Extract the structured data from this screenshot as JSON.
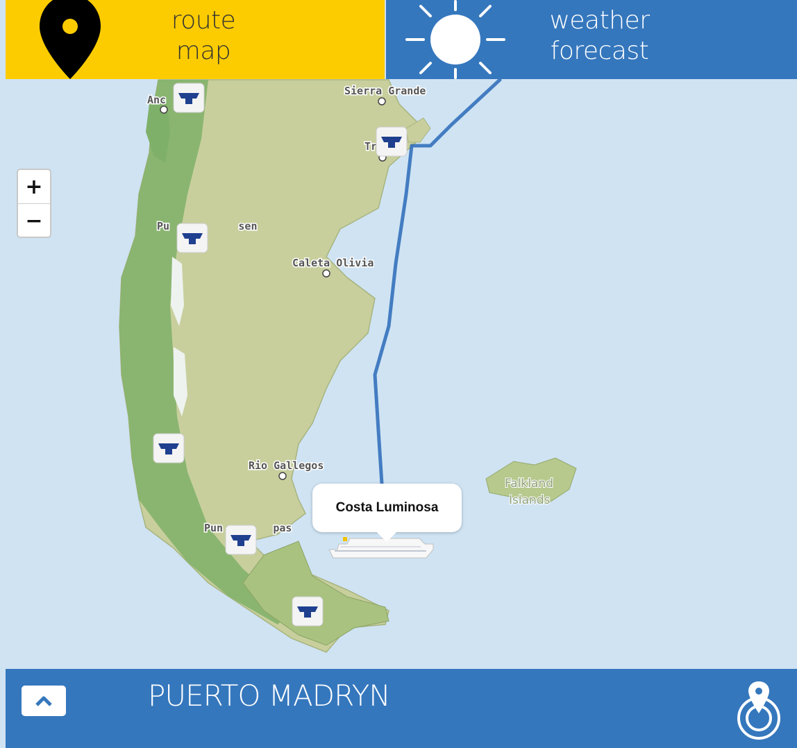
{
  "header": {
    "route_tab": {
      "label": "route\nmap",
      "icon": "map-pin-icon",
      "color": "#fdcc00"
    },
    "weather_tab": {
      "label": "weather\nforecast",
      "icon": "sun-icon",
      "color": "#3577bd"
    }
  },
  "map": {
    "zoom_in_label": "+",
    "zoom_out_label": "−",
    "ocean_color": "#cfe3f3",
    "land_color": "#c8cf9d",
    "route_color": "#2a6ab7",
    "places": [
      {
        "label": "Sierra Grande"
      },
      {
        "label": "Tr"
      },
      {
        "label": "Anc"
      },
      {
        "label": "Pu           sen"
      },
      {
        "label": "Caleta Olivia"
      },
      {
        "label": "Rio Gallegos"
      },
      {
        "label": "Pun        pas"
      },
      {
        "label": "Falkland"
      },
      {
        "label": "Islands"
      }
    ],
    "port_icon": "ship-port-icon",
    "ship": {
      "name": "Costa Luminosa",
      "icon": "cruise-ship-icon"
    }
  },
  "footer": {
    "port_name": "PUERTO MADRYN",
    "expand_icon": "chevron-up-icon",
    "locate_icon": "locate-target-icon"
  }
}
